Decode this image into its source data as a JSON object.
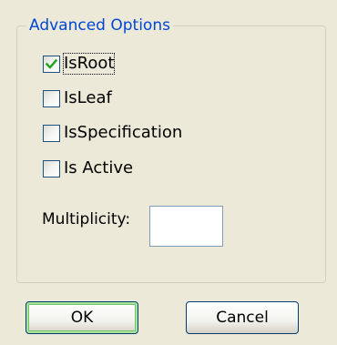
{
  "group": {
    "title": "Advanced Options"
  },
  "options": [
    {
      "label": "IsRoot",
      "checked": true
    },
    {
      "label": "IsLeaf",
      "checked": false
    },
    {
      "label": "IsSpecification",
      "checked": false
    },
    {
      "label": "Is Active",
      "checked": false
    }
  ],
  "multiplicity": {
    "label": "Multiplicity:",
    "value": ""
  },
  "buttons": {
    "ok": "OK",
    "cancel": "Cancel"
  },
  "colors": {
    "group_title": "#0046d5",
    "checkmark": "#21a121",
    "dialog_background": "#ece9d8"
  },
  "icons": {
    "checkmark": "check-icon"
  }
}
